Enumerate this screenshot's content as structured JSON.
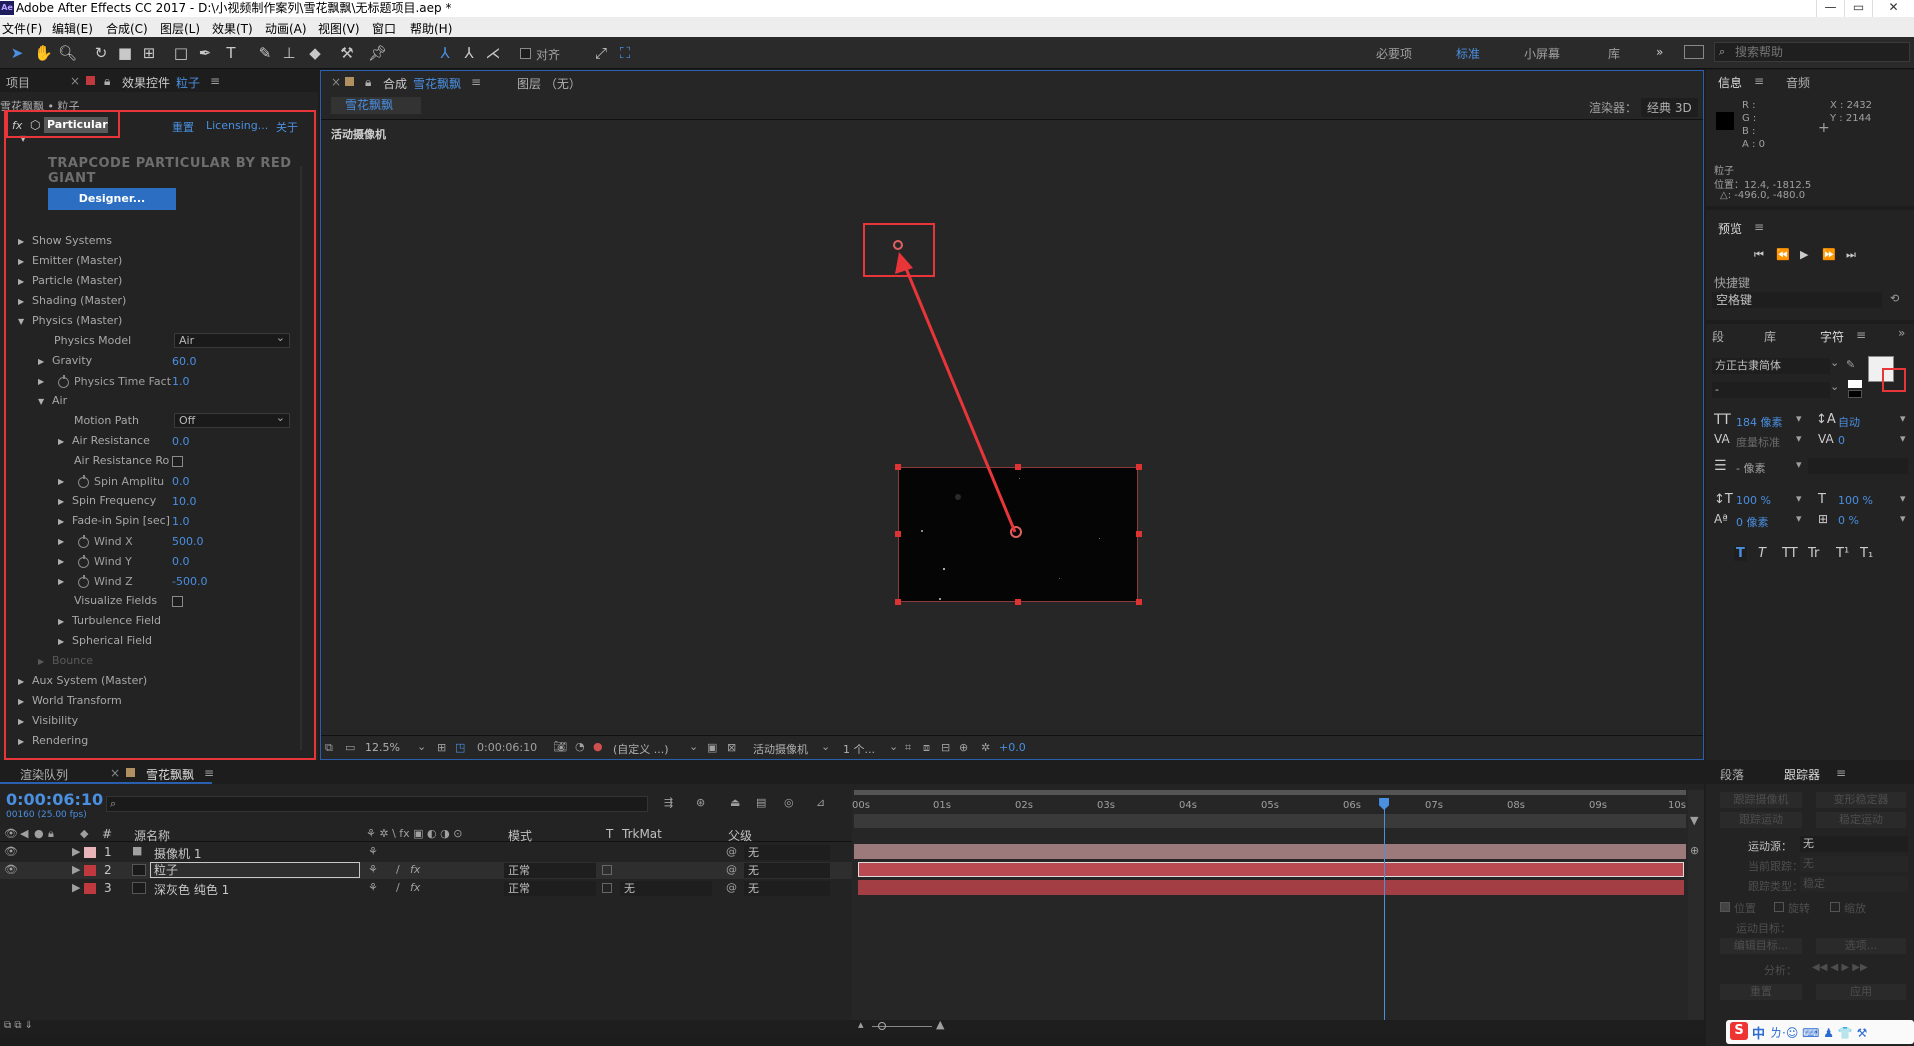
{
  "titlebar": {
    "title": "Adobe After Effects CC 2017 - D:\\小视频制作案列\\雪花飘飘\\无标题项目.aep *",
    "logo": "Ae"
  },
  "menu": [
    "文件(F)",
    "编辑(E)",
    "合成(C)",
    "图层(L)",
    "效果(T)",
    "动画(A)",
    "视图(V)",
    "窗口",
    "帮助(H)"
  ],
  "toolbar": {
    "snap_label": "对齐",
    "workspaces": [
      "必要项",
      "标准",
      "小屏幕",
      "库"
    ],
    "search_placeholder": "搜索帮助"
  },
  "effect_panel": {
    "tab_project": "项目",
    "tab_effects": "效果控件",
    "layer_name": "粒子",
    "breadcrumb": "雪花飘飘 • 粒子",
    "effect_name": "Particular",
    "reset": "重置",
    "licensing": "Licensing...",
    "about": "关于",
    "brand": "TRAPCODE PARTICULAR BY RED GIANT",
    "designer": "Designer...",
    "rows": [
      {
        "label": "Show Systems"
      },
      {
        "label": "Emitter (Master)"
      },
      {
        "label": "Particle (Master)"
      },
      {
        "label": "Shading (Master)"
      },
      {
        "label": "Physics (Master)"
      },
      {
        "label": "Physics Model",
        "value": "Air"
      },
      {
        "label": "Gravity",
        "value": "60.0"
      },
      {
        "label": "Physics Time Fact",
        "value": "1.0"
      },
      {
        "label": "Air"
      },
      {
        "label": "Motion Path",
        "value": "Off"
      },
      {
        "label": "Air Resistance",
        "value": "0.0"
      },
      {
        "label": "Air Resistance Ro"
      },
      {
        "label": "Spin Amplitu",
        "value": "0.0"
      },
      {
        "label": "Spin Frequency",
        "value": "10.0"
      },
      {
        "label": "Fade-in Spin [sec]",
        "value": "1.0"
      },
      {
        "label": "Wind X",
        "value": "500.0"
      },
      {
        "label": "Wind Y",
        "value": "0.0"
      },
      {
        "label": "Wind Z",
        "value": "-500.0"
      },
      {
        "label": "Visualize Fields"
      },
      {
        "label": "Turbulence Field"
      },
      {
        "label": "Spherical Field"
      },
      {
        "label": "Bounce"
      },
      {
        "label": "Aux System (Master)"
      },
      {
        "label": "World Transform"
      },
      {
        "label": "Visibility"
      },
      {
        "label": "Rendering"
      }
    ]
  },
  "comp_panel": {
    "tab_prefix": "合成",
    "comp_name": "雪花飘飘",
    "layer_tab": "图层 （无）",
    "subtab": "雪花飘飘",
    "renderer_label": "渲染器：",
    "renderer_value": "经典 3D",
    "camera_label": "活动摄像机",
    "zoom": "12.5%",
    "timecode": "0:00:06:10",
    "resolution": "(自定义 ...)",
    "view": "活动摄像机",
    "views_count": "1 个...",
    "exposure": "+0.0"
  },
  "info_panel": {
    "tab_info": "信息",
    "tab_audio": "音频",
    "r": "R :",
    "g": "G :",
    "b": "B :",
    "a": "A : 0",
    "x": "X : 2432",
    "y": "Y : 2144",
    "layer": "粒子",
    "position": "位置：12.4, -1812.5",
    "delta": "△: -496.0, -480.0"
  },
  "preview_panel": {
    "title": "预览",
    "shortcut_label": "快捷键",
    "shortcut_value": "空格键"
  },
  "char_panel": {
    "tab_para": "段",
    "tab_lib": "库",
    "tab_char": "字符",
    "font": "方正古隶简体",
    "style": "-",
    "size": "184 像素",
    "leading": "自动",
    "kerning": "度量标准",
    "tracking": "0",
    "stroke": "- 像素",
    "vscale": "100 %",
    "hscale": "100 %",
    "baseline": "0 像素",
    "tsume": "0 %",
    "styles": [
      "T",
      "T",
      "TT",
      "Tr",
      "T¹",
      "T₁"
    ]
  },
  "tracker_panel": {
    "tab_para": "段落",
    "tab_tracker": "跟踪器",
    "track_camera": "跟踪摄像机",
    "warp_stab": "变形稳定器",
    "track_motion": "跟踪运动",
    "stabilize": "稳定运动",
    "source_label": "运动源：",
    "source_value": "无",
    "current_track": "当前跟踪：",
    "current_value": "无",
    "track_type": "跟踪类型：",
    "track_type_value": "稳定",
    "position": "位置",
    "rotation": "旋转",
    "scale": "缩放",
    "motion_target": "运动目标：",
    "edit_target": "编辑目标...",
    "options": "选项...",
    "analyze": "分析：",
    "reset": "重置",
    "apply": "应用"
  },
  "timeline": {
    "tab_render": "渲染队列",
    "tab_comp": "雪花飘飘",
    "timecode": "0:00:06:10",
    "frames": "00160 (25.00 fps)",
    "search_placeholder": "",
    "col_num": "#",
    "col_name": "源名称",
    "col_mode": "模式",
    "col_t": "T",
    "col_trkmat": "TrkMat",
    "col_parent": "父级",
    "ruler": [
      "00s",
      "01s",
      "02s",
      "03s",
      "04s",
      "05s",
      "06s",
      "07s",
      "08s",
      "09s",
      "10s"
    ],
    "playhead_seconds": 6.4,
    "duration_seconds": 10,
    "layers": [
      {
        "num": "1",
        "name": "摄像机 1",
        "mode": "",
        "trkmat": "",
        "parent": "无",
        "color": "#e8b4b8",
        "bar": "#9c7a7c"
      },
      {
        "num": "2",
        "name": "粒子",
        "mode": "正常",
        "trkmat": "",
        "parent": "无",
        "color": "#c0393f",
        "bar": "#b94a52"
      },
      {
        "num": "3",
        "name": "深灰色 纯色 1",
        "mode": "正常",
        "trkmat": "无",
        "parent": "无",
        "color": "#c0393f",
        "bar": "#a23e44"
      }
    ]
  },
  "taskbar": {
    "ime": "中",
    "symbols": "ㄌ·☺ ⌨ ♟ 👕 ⚒"
  }
}
